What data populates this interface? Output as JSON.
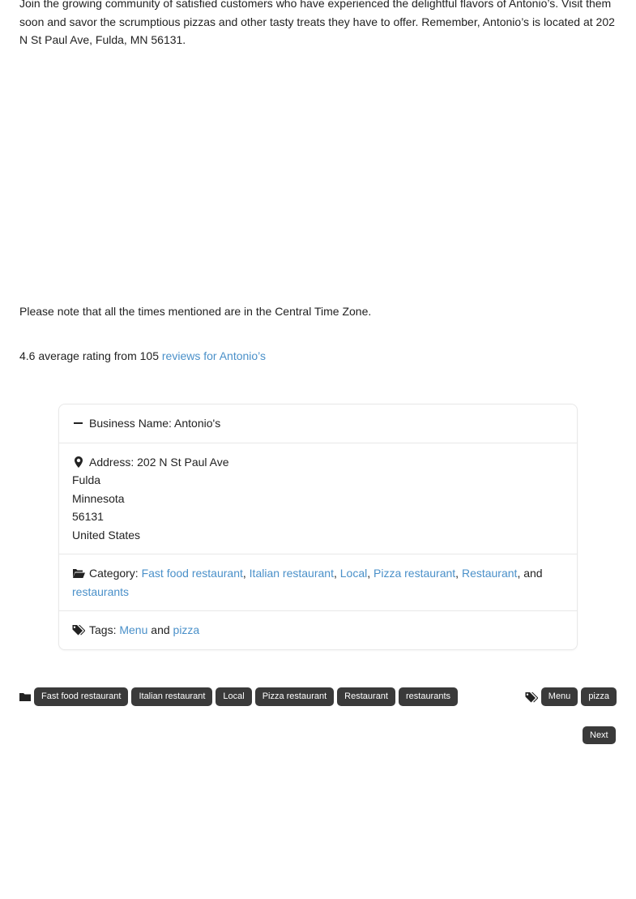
{
  "intro_text": "Join the growing community of satisfied customers who have experienced the delightful flavors of Antonio’s. Visit them soon and savor the scrumptious pizzas and other tasty treats they have to offer. Remember, Antonio’s is located at 202 N St Paul Ave, Fulda, MN 56131.",
  "timezone_note": "Please note that all the times mentioned are in the Central Time Zone.",
  "rating": {
    "text": "4.6 average rating from 105",
    "link": "reviews for Antonio’s"
  },
  "business": {
    "name_label": "Business Name: Antonio's",
    "address_label": "Address: 202 N St Paul Ave",
    "city": "Fulda",
    "state": "Minnesota",
    "zip": "56131",
    "country": "United States",
    "category_label": "Category:",
    "categories": [
      "Fast food restaurant",
      "Italian restaurant",
      "Local",
      "Pizza restaurant",
      "Restaurant"
    ],
    "category_and": ", and",
    "category_last": "restaurants",
    "tags_label": "Tags:",
    "tags": [
      "Menu",
      "pizza"
    ],
    "tags_and": "and"
  },
  "footer": {
    "category_pills": [
      "Fast food restaurant",
      "Italian restaurant",
      "Local",
      "Pizza restaurant",
      "Restaurant",
      "restaurants"
    ],
    "tag_pills": [
      "Menu",
      "pizza"
    ],
    "next_label": "Next"
  },
  "icons": [
    "minus-icon",
    "map-marker-icon",
    "folder-open-icon",
    "tags-icon",
    "folder-icon"
  ]
}
